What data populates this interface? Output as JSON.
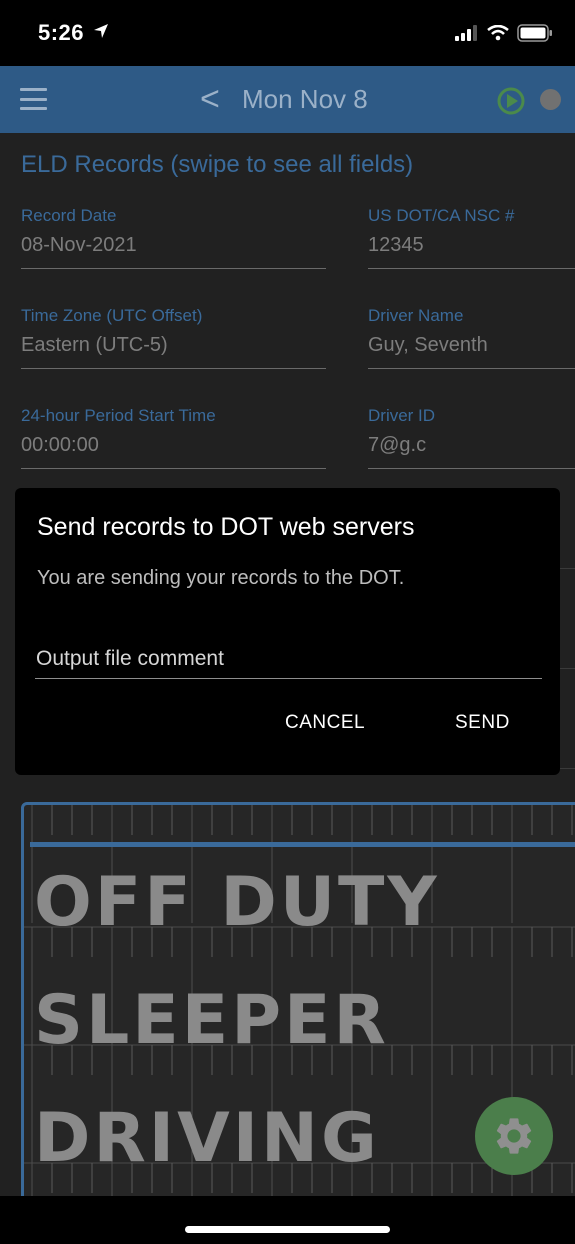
{
  "status_bar": {
    "time": "5:26"
  },
  "navbar": {
    "back_glyph": "<",
    "title": "Mon Nov 8"
  },
  "eld": {
    "section_title": "ELD Records (swipe to see all fields)",
    "fields": [
      {
        "label": "Record Date",
        "value": "08-Nov-2021"
      },
      {
        "label": "US DOT/CA NSC #",
        "value": "12345"
      },
      {
        "label": "Time Zone (UTC Offset)",
        "value": "Eastern (UTC-5)"
      },
      {
        "label": "Driver Name",
        "value": "Guy, Seventh"
      },
      {
        "label": "24-hour Period Start Time",
        "value": "00:00:00"
      },
      {
        "label": "Driver ID",
        "value": "7@g.c"
      }
    ]
  },
  "dialog": {
    "title": "Send records to DOT web servers",
    "message": "You are sending your records to the DOT.",
    "input_placeholder": "Output file comment",
    "cancel_label": "CANCEL",
    "send_label": "SEND"
  },
  "graph": {
    "rows": [
      "OFF DUTY",
      "SLEEPER",
      "DRIVING"
    ]
  },
  "colors": {
    "accent": "#2e5a86",
    "label_blue": "#3a6a9a",
    "fab_green": "#4b7e4b"
  },
  "icons": {
    "location": "location-arrow-icon",
    "signal": "signal-icon",
    "wifi": "wifi-icon",
    "battery": "battery-icon",
    "menu": "hamburger-menu-icon",
    "settings": "gear-icon"
  }
}
